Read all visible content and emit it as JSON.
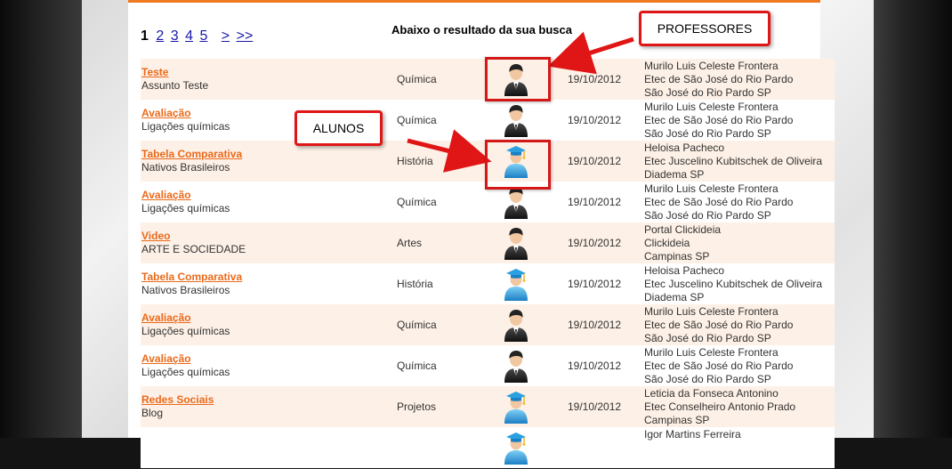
{
  "pagination": {
    "current": "1",
    "pages": [
      "2",
      "3",
      "4",
      "5"
    ],
    "next": ">",
    "last": ">>"
  },
  "results_heading": "Abaixo o resultado da sua busca",
  "annotations": {
    "professores_label": "PROFESSORES",
    "alunos_label": "ALUNOS"
  },
  "results": [
    {
      "title": "Teste",
      "subtitle": "Assunto Teste",
      "subject": "Química",
      "role_icon": "teacher-icon",
      "date": "19/10/2012",
      "author_name": "Murilo Luis Celeste Frontera",
      "author_school": "Etec de São José do Rio Pardo",
      "author_city": "São José do Rio Pardo SP"
    },
    {
      "title": "Avaliação",
      "subtitle": "Ligações químicas",
      "subject": "Química",
      "role_icon": "teacher-icon",
      "date": "19/10/2012",
      "author_name": "Murilo Luis Celeste Frontera",
      "author_school": "Etec de São José do Rio Pardo",
      "author_city": "São José do Rio Pardo SP"
    },
    {
      "title": "Tabela Comparativa",
      "subtitle": "Nativos Brasileiros",
      "subject": "História",
      "role_icon": "student-icon",
      "date": "19/10/2012",
      "author_name": "Heloisa Pacheco",
      "author_school": "Etec Juscelino Kubitschek de Oliveira",
      "author_city": "Diadema SP"
    },
    {
      "title": "Avaliação",
      "subtitle": "Ligações químicas",
      "subject": "Química",
      "role_icon": "teacher-icon",
      "date": "19/10/2012",
      "author_name": "Murilo Luis Celeste Frontera",
      "author_school": "Etec de São José do Rio Pardo",
      "author_city": "São José do Rio Pardo SP"
    },
    {
      "title": "Video",
      "subtitle": "ARTE E SOCIEDADE",
      "subject": "Artes",
      "role_icon": "teacher-icon",
      "date": "19/10/2012",
      "author_name": "Portal Clickideia",
      "author_school": "Clickideia",
      "author_city": "Campinas SP"
    },
    {
      "title": "Tabela Comparativa",
      "subtitle": "Nativos Brasileiros",
      "subject": "História",
      "role_icon": "student-icon",
      "date": "19/10/2012",
      "author_name": "Heloisa Pacheco",
      "author_school": "Etec Juscelino Kubitschek de Oliveira",
      "author_city": "Diadema SP"
    },
    {
      "title": "Avaliação",
      "subtitle": "Ligações químicas",
      "subject": "Química",
      "role_icon": "teacher-icon",
      "date": "19/10/2012",
      "author_name": "Murilo Luis Celeste Frontera",
      "author_school": "Etec de São José do Rio Pardo",
      "author_city": "São José do Rio Pardo SP"
    },
    {
      "title": "Avaliação",
      "subtitle": "Ligações químicas",
      "subject": "Química",
      "role_icon": "teacher-icon",
      "date": "19/10/2012",
      "author_name": "Murilo Luis Celeste Frontera",
      "author_school": "Etec de São José do Rio Pardo",
      "author_city": "São José do Rio Pardo SP"
    },
    {
      "title": "Redes Sociais",
      "subtitle": "Blog",
      "subject": "Projetos",
      "role_icon": "student-icon",
      "date": "19/10/2012",
      "author_name": "Leticia da Fonseca Antonino",
      "author_school": "Etec Conselheiro Antonio Prado",
      "author_city": "Campinas SP"
    },
    {
      "title": "",
      "subtitle": "",
      "subject": "",
      "role_icon": "student-icon",
      "date": "",
      "author_name": "Igor Martins Ferreira",
      "author_school": "",
      "author_city": ""
    }
  ],
  "colors": {
    "accent_orange": "#ea6a1b",
    "row_alt": "#fdf0e6",
    "annotation_red": "#e01616",
    "link_blue": "#1a1aa6"
  }
}
